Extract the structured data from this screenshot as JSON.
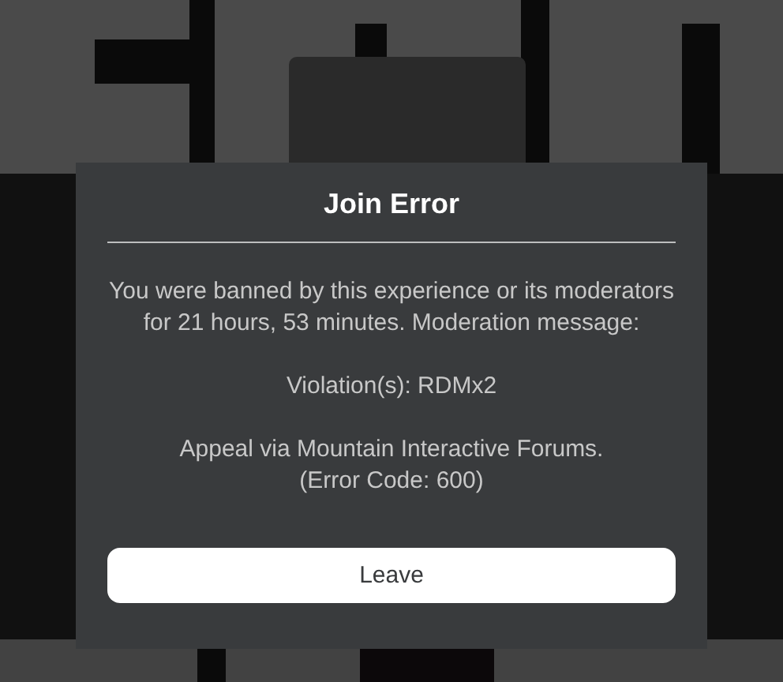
{
  "dialog": {
    "title": "Join Error",
    "message": [
      "You were banned by this experience or its moderators for 21 hours, 53 minutes. Moderation message:",
      "Violation(s): RDMx2"
    ],
    "footer_lines": [
      "Appeal via Mountain Interactive Forums.",
      "(Error Code: 600)"
    ],
    "button": "Leave"
  }
}
